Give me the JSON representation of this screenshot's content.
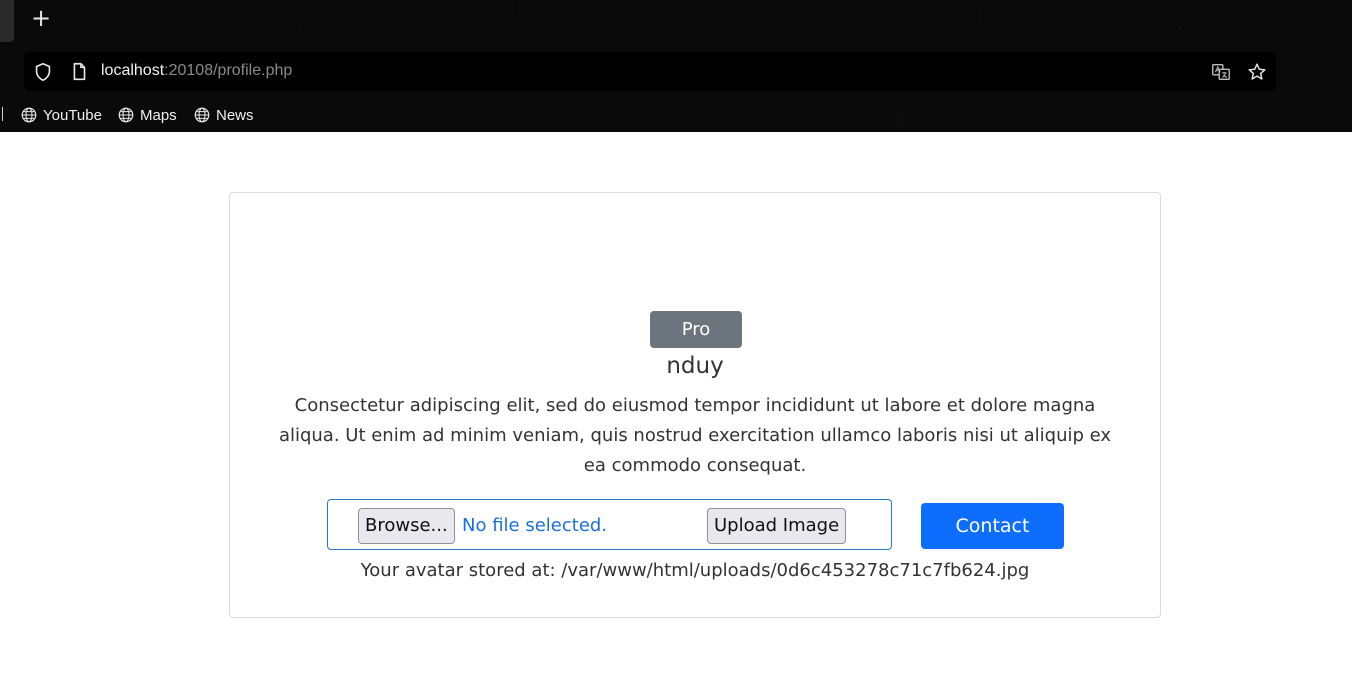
{
  "browser": {
    "new_tab_label": "+",
    "url_host": "localhost",
    "url_rest": ":20108/profile.php",
    "bookmarks": [
      {
        "label": "YouTube"
      },
      {
        "label": "Maps"
      },
      {
        "label": "News"
      }
    ]
  },
  "profile": {
    "badge": "Pro",
    "username": "nduy",
    "bio": "Consectetur adipiscing elit, sed do eiusmod tempor incididunt ut labore et dolore magna aliqua. Ut enim ad minim veniam, quis nostrud exercitation ullamco laboris nisi ut aliquip ex ea commodo consequat.",
    "upload": {
      "browse_label": "Browse...",
      "file_status": "No file selected.",
      "upload_label": "Upload Image"
    },
    "contact_label": "Contact",
    "avatar_path": "Your avatar stored at: /var/www/html/uploads/0d6c453278c71c7fb624.jpg"
  },
  "colors": {
    "badge_bg": "#6c757d",
    "primary": "#0d6efd",
    "file_status": "#1a6fd8"
  }
}
